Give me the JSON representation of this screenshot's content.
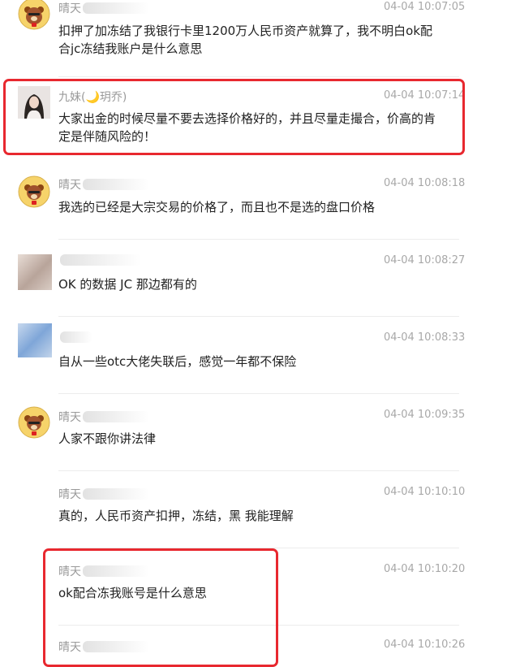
{
  "messages": [
    {
      "sender": "晴天",
      "time": "04-04 10:07:05",
      "text": "扣押了加冻结了我银行卡里1200万人民币资产就算了，我不明白ok配合jc冻结我账户是什么意思"
    },
    {
      "sender_prefix": "九妹(",
      "sender_moon": "🌙",
      "sender_suffix": "玥乔)",
      "time": "04-04 10:07:14",
      "text": "大家出金的时候尽量不要去选择价格好的，并且尽量走撮合，价高的肯定是伴随风险的！"
    },
    {
      "sender": "晴天",
      "time": "04-04 10:08:18",
      "text": "我选的已经是大宗交易的价格了，而且也不是选的盘口价格"
    },
    {
      "sender": "",
      "time": "04-04 10:08:27",
      "text": "OK 的数据 JC 那边都有的"
    },
    {
      "sender": "",
      "time": "04-04 10:08:33",
      "text": "自从一些otc大佬失联后，感觉一年都不保险"
    },
    {
      "sender": "晴天",
      "time": "04-04 10:09:35",
      "text": "人家不跟你讲法律"
    },
    {
      "sender": "晴天",
      "time": "04-04 10:10:10",
      "text": "真的，人民币资产扣押，冻结，黑 我能理解"
    },
    {
      "sender": "晴天",
      "time": "04-04 10:10:20",
      "text": "ok配合冻我账号是什么意思"
    },
    {
      "sender": "晴天",
      "time": "04-04 10:10:26",
      "text": ""
    }
  ],
  "colors": {
    "highlight": "#e8282f",
    "timestamp": "#a8a8a8",
    "sender": "#9a9a9a"
  },
  "icons": {
    "avatar_bear": "cartoon-bear-avatar",
    "avatar_girl": "girl-photo-avatar",
    "avatar_blurred": "blurred-avatar"
  }
}
